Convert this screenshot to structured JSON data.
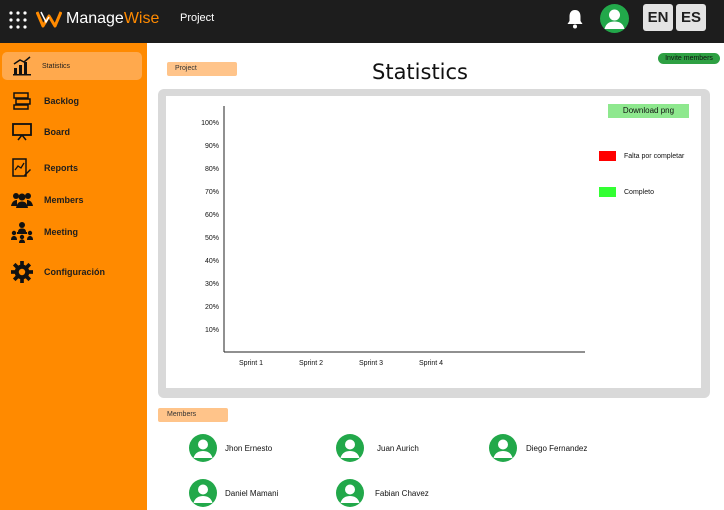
{
  "topbar": {
    "app_name_part1": "Manage",
    "app_name_part2": "Wise",
    "project_link": "Project",
    "languages": [
      "EN",
      "ES"
    ],
    "accent_color": "#ff8a00",
    "avatar_color": "#22a84a"
  },
  "sidebar": {
    "items": [
      {
        "label": "Statistics",
        "icon": "bar-chart-icon",
        "active": true
      },
      {
        "label": "Backlog",
        "icon": "backlog-icon",
        "active": false
      },
      {
        "label": "Board",
        "icon": "board-icon",
        "active": false
      },
      {
        "label": "Reports",
        "icon": "reports-icon",
        "active": false
      },
      {
        "label": "Members",
        "icon": "members-icon",
        "active": false
      },
      {
        "label": "Meeting",
        "icon": "meeting-icon",
        "active": false
      },
      {
        "label": "Configuración",
        "icon": "gear-icon",
        "active": false
      }
    ]
  },
  "main": {
    "project_tag": "Project",
    "title": "Statistics",
    "invite_button": "Invite members",
    "download_button": "Download png",
    "members_tag": "Members"
  },
  "chart_data": {
    "type": "bar",
    "categories": [
      "Sprint 1",
      "Sprint 2",
      "Sprint 3",
      "Sprint 4"
    ],
    "y_ticks": [
      "10%",
      "20%",
      "30%",
      "40%",
      "50%",
      "60%",
      "70%",
      "80%",
      "90%",
      "100%"
    ],
    "series": [
      {
        "name": "Falta por completar",
        "color": "#ff0000",
        "values": [
          0,
          0,
          0,
          0
        ]
      },
      {
        "name": "Completo",
        "color": "#33ff33",
        "values": [
          0,
          0,
          0,
          0
        ]
      }
    ],
    "ylim": [
      0,
      100
    ],
    "legend_position": "right"
  },
  "members": [
    {
      "name": "Jhon Ernesto"
    },
    {
      "name": "Juan Aurich"
    },
    {
      "name": "Diego Fernandez"
    },
    {
      "name": "Daniel Mamani"
    },
    {
      "name": "Fabian Chavez"
    }
  ]
}
